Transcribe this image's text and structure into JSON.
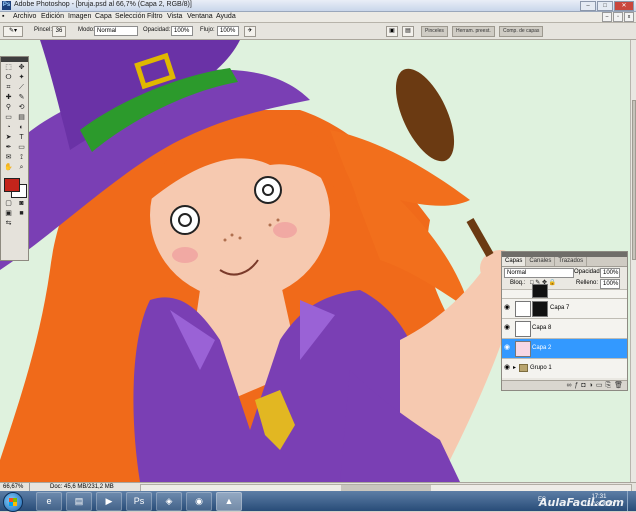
{
  "window": {
    "app_icon": "Ps",
    "title": "Adobe Photoshop - [bruja.psd al 66,7% (Capa 2, RGB/8)]",
    "buttons": [
      "minimize",
      "maximize",
      "close"
    ]
  },
  "menubar": {
    "items": [
      "Archivo",
      "Edición",
      "Imagen",
      "Capa",
      "Selección",
      "Filtro",
      "Vista",
      "Ventana",
      "Ayuda"
    ]
  },
  "options": {
    "pincel_label": "Pincel:",
    "pincel_size": "36",
    "modo_label": "Modo:",
    "modo_value": "Normal",
    "opacidad_label": "Opacidad:",
    "opacidad_value": "100%",
    "flujo_label": "Flujo:",
    "flujo_value": "100%",
    "wells": [
      "Pinceles",
      "Herram. preest.",
      "Comp. de capas"
    ]
  },
  "toolbox": {
    "tools": [
      "move-tool",
      "marquee-tool",
      "lasso-tool",
      "magic-wand-tool",
      "crop-tool",
      "slice-tool",
      "healing-brush-tool",
      "brush-tool",
      "clone-stamp-tool",
      "history-brush-tool",
      "eraser-tool",
      "gradient-tool",
      "blur-tool",
      "dodge-tool",
      "path-selection-tool",
      "type-tool",
      "pen-tool",
      "shape-tool",
      "notes-tool",
      "eyedropper-tool",
      "hand-tool",
      "zoom-tool"
    ],
    "foreground_color": "#c4241b",
    "background_color": "#ffffff"
  },
  "layers_panel": {
    "tabs": [
      "Capas",
      "Canales",
      "Trazados"
    ],
    "blend_mode": "Normal",
    "opacity_label": "Opacidad:",
    "opacity_value": "100%",
    "lock_label": "Bloq.:",
    "fill_label": "Relleno:",
    "fill_value": "100%",
    "layers": [
      {
        "name": "Capa 7",
        "selected": false
      },
      {
        "name": "Capa 8",
        "selected": false
      },
      {
        "name": "Capa 2",
        "selected": true
      },
      {
        "name": "Grupo 1",
        "selected": false
      }
    ]
  },
  "status": {
    "zoom": "66,67%",
    "doc_info": "Doc: 45,6 MB/231,2 MB"
  },
  "taskbar": {
    "apps": [
      "ie-icon",
      "explorer-icon",
      "media-player-icon",
      "photoshop-icon",
      "chrome-icon",
      "app-icon"
    ],
    "language": "ES",
    "time": "17:31",
    "date": "15/03/2010",
    "watermark": "AulaFacil.com"
  },
  "colors": {
    "canvas_bg": "#dff2de",
    "hair": "#f06a1a",
    "hat": "#7a3fb4",
    "band": "#2c9a2c",
    "selection": "#3399ff"
  }
}
